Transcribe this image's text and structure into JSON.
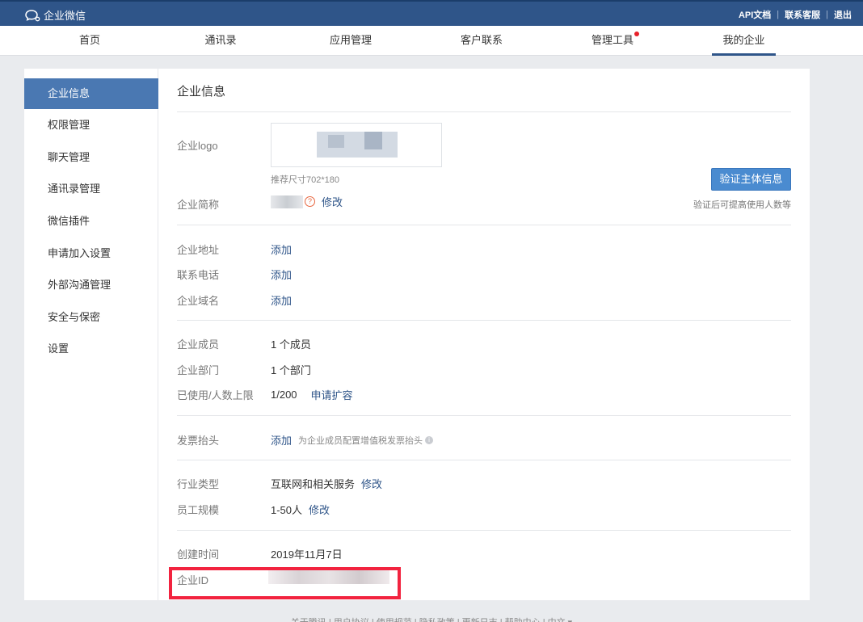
{
  "topbar": {
    "logo_text": "企业微信",
    "links": [
      "API文档",
      "联系客服",
      "退出"
    ]
  },
  "nav": {
    "items": [
      "首页",
      "通讯录",
      "应用管理",
      "客户联系",
      "管理工具",
      "我的企业"
    ],
    "active": "我的企业",
    "dot_item": "管理工具"
  },
  "sidebar": {
    "items": [
      "企业信息",
      "权限管理",
      "聊天管理",
      "通讯录管理",
      "微信插件",
      "申请加入设置",
      "外部沟通管理",
      "安全与保密",
      "设置"
    ],
    "active": "企业信息"
  },
  "main": {
    "title": "企业信息",
    "logo_label": "企业logo",
    "logo_size_hint": "推荐尺寸702*180",
    "verify_button": "验证主体信息",
    "verify_hint": "验证后可提高使用人数等",
    "short_name_label": "企业简称",
    "edit": "修改",
    "add": "添加",
    "address_label": "企业地址",
    "phone_label": "联系电话",
    "domain_label": "企业域名",
    "members_label": "企业成员",
    "members_value": "1 个成员",
    "departments_label": "企业部门",
    "departments_value": "1 个部门",
    "usage_label": "已使用/人数上限",
    "usage_value": "1/200",
    "expand_link": "申请扩容",
    "invoice_label": "发票抬头",
    "invoice_hint": "为企业成员配置增值税发票抬头",
    "industry_label": "行业类型",
    "industry_value": "互联网和相关服务",
    "scale_label": "员工规模",
    "scale_value": "1-50人",
    "created_label": "创建时间",
    "created_value": "2019年11月7日",
    "corp_id_label": "企业ID"
  },
  "colors": {
    "topbar": "#2f5589",
    "sidebar_active": "#4a78b2",
    "link": "#2f5589",
    "button": "#4a8bd0",
    "highlight_box": "#f2233f"
  },
  "icons": [
    "chat-bubble-logo-icon",
    "question-icon",
    "info-icon"
  ],
  "footer": {
    "text": "关于腾讯 | 用户协议 | 使用规范 | 隐私政策 | 更新日志 | 帮助中心 | 中文 ▾"
  }
}
